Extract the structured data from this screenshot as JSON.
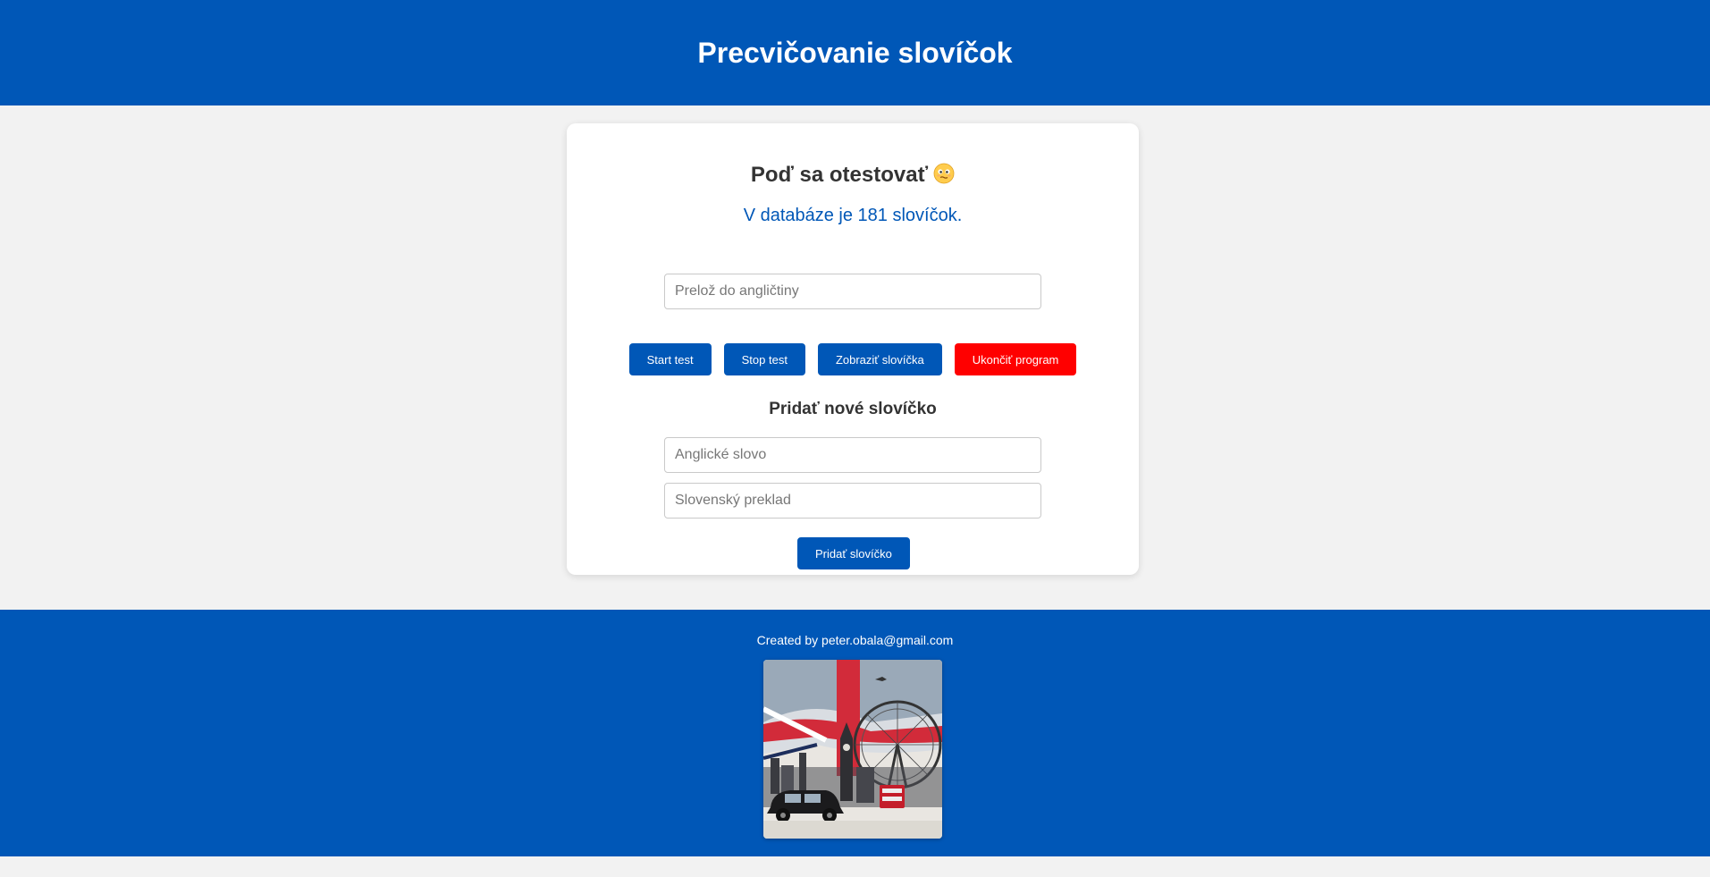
{
  "header": {
    "title": "Precvičovanie slovíčok"
  },
  "test": {
    "title": "Poď sa otestovať",
    "emoji": "face-emoji-icon",
    "count_text": "V databáze je 181 slovíčok.",
    "translate_placeholder": "Prelož do angličtiny",
    "translate_value": ""
  },
  "buttons": {
    "start": "Start test",
    "stop": "Stop test",
    "show": "Zobraziť slovíčka",
    "quit": "Ukončiť program"
  },
  "add": {
    "title": "Pridať nové slovíčko",
    "english_placeholder": "Anglické slovo",
    "slovak_placeholder": "Slovenský preklad",
    "button": "Pridať slovíčko"
  },
  "footer": {
    "credit": "Created by peter.obala@gmail.com",
    "image": "london-illustration-image"
  },
  "colors": {
    "primary": "#0057b7",
    "danger": "#ff0000",
    "background": "#f2f2f2"
  }
}
